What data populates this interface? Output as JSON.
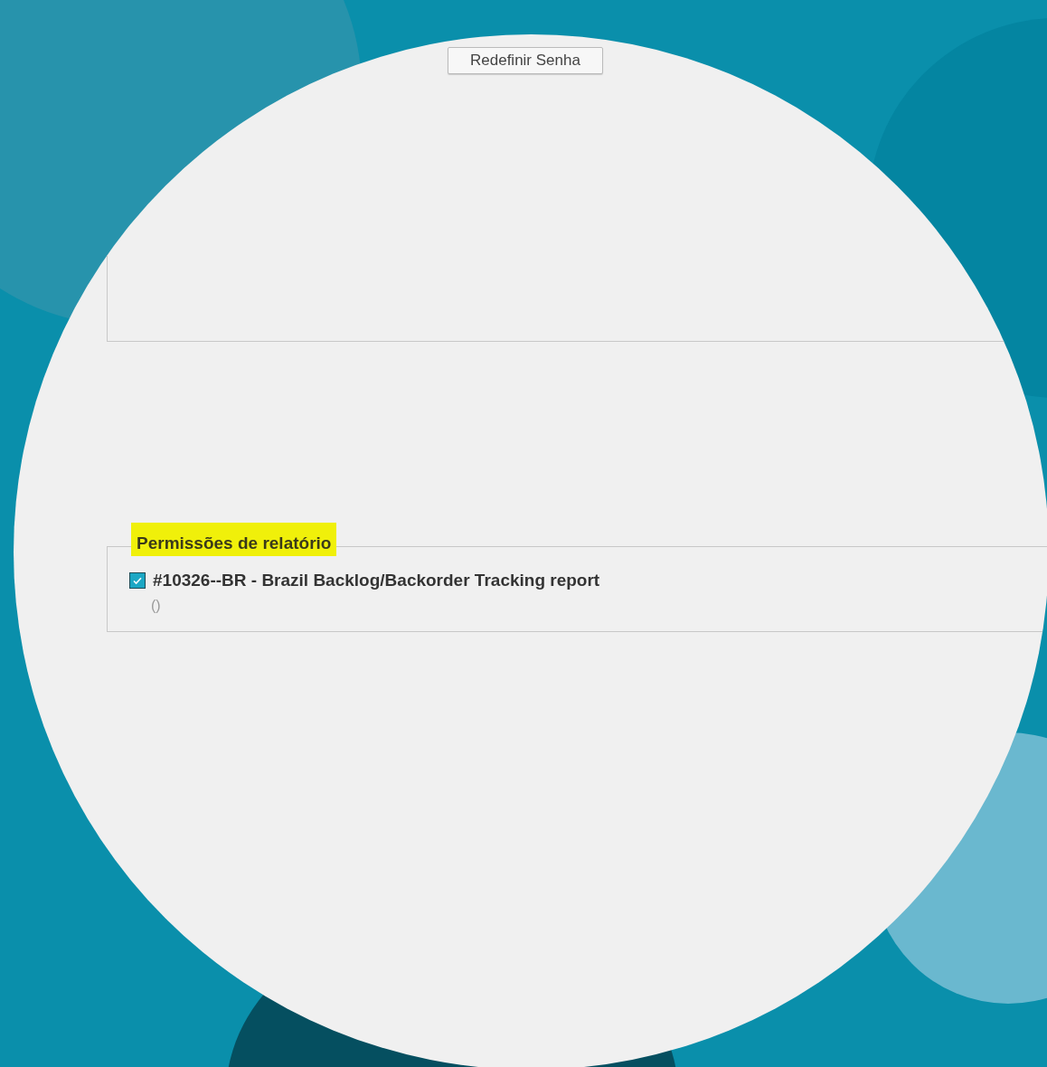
{
  "buttons": [
    {
      "label": "Redefinir Senha"
    }
  ],
  "report_permissions": {
    "title": "Permissões de relatório",
    "title_highlighted": true,
    "items": [
      {
        "label": "#10326--BR - Brazil Backlog/Backorder Tracking report",
        "checked": true,
        "note": "()"
      }
    ]
  }
}
